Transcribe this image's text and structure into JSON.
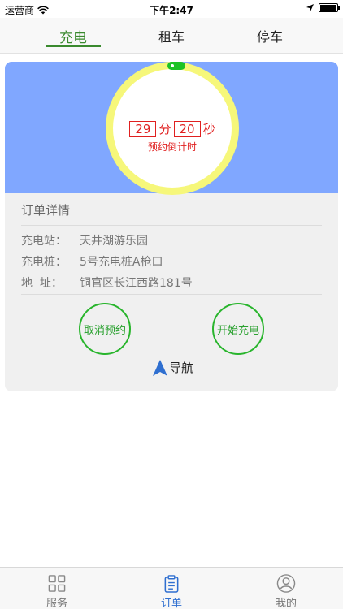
{
  "status_bar": {
    "carrier": "运营商",
    "time": "下午2:47"
  },
  "top_tabs": [
    {
      "label": "充电",
      "active": true
    },
    {
      "label": "租车",
      "active": false
    },
    {
      "label": "停车",
      "active": false
    }
  ],
  "countdown": {
    "minutes": "29",
    "minutes_unit": "分",
    "seconds": "20",
    "seconds_unit": "秒",
    "label": "预约倒计时"
  },
  "order": {
    "title": "订单详情",
    "rows": [
      {
        "label": "充电站：",
        "value": "天井湖游乐园"
      },
      {
        "label": "充电桩：",
        "value": "5号充电桩A枪口"
      },
      {
        "label": "地  址：",
        "value": "铜官区长江西路181号"
      }
    ]
  },
  "actions": {
    "cancel_label": "取消预约",
    "start_label": "开始充电",
    "navigate_label": "导航"
  },
  "tab_bar": [
    {
      "label": "服务",
      "icon": "grid-icon",
      "active": false
    },
    {
      "label": "订单",
      "icon": "clipboard-icon",
      "active": true
    },
    {
      "label": "我的",
      "icon": "user-icon",
      "active": false
    }
  ],
  "colors": {
    "accent_green": "#3a8a2e",
    "banner_blue": "#80a7ff",
    "ring_yellow": "#f6f77a",
    "countdown_red": "#e02020",
    "tab_active_blue": "#2f6fd0"
  }
}
